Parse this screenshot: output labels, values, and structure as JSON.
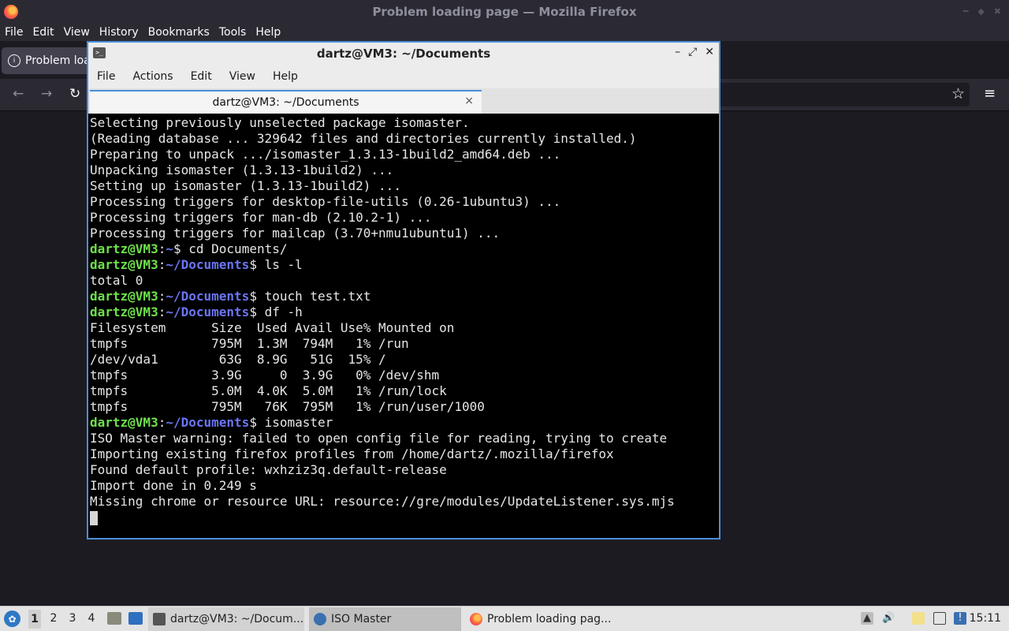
{
  "colors": {
    "terminal_user": "#6ee04c",
    "terminal_path": "#6a75f2",
    "terminal_bg": "#000000",
    "focus_accent": "#4a8fd8",
    "firefox_chrome": "#2b2a33"
  },
  "firefox": {
    "title": "Problem loading page — Mozilla Firefox",
    "menu": [
      "File",
      "Edit",
      "View",
      "History",
      "Bookmarks",
      "Tools",
      "Help"
    ],
    "tab_label": "Problem loa",
    "icons": {
      "back": "arrow-left-icon",
      "forward": "arrow-right-icon",
      "reload": "reload-icon",
      "bookmark": "star-icon",
      "menu": "hamburger-icon"
    }
  },
  "terminal": {
    "title": "dartz@VM3: ~/Documents",
    "menu": [
      "File",
      "Actions",
      "Edit",
      "View",
      "Help"
    ],
    "tab_label": "dartz@VM3: ~/Documents",
    "tab_close": "×",
    "lines": [
      {
        "text": "Selecting previously unselected package isomaster."
      },
      {
        "text": "(Reading database ... 329642 files and directories currently installed.)"
      },
      {
        "text": "Preparing to unpack .../isomaster_1.3.13-1build2_amd64.deb ..."
      },
      {
        "text": "Unpacking isomaster (1.3.13-1build2) ..."
      },
      {
        "text": "Setting up isomaster (1.3.13-1build2) ..."
      },
      {
        "text": "Processing triggers for desktop-file-utils (0.26-1ubuntu3) ..."
      },
      {
        "text": "Processing triggers for man-db (2.10.2-1) ..."
      },
      {
        "text": "Processing triggers for mailcap (3.70+nmu1ubuntu1) ..."
      },
      {
        "user": "dartz@VM3",
        "path": "~",
        "cmd": " cd Documents/"
      },
      {
        "user": "dartz@VM3",
        "path": "~/Documents",
        "cmd": " ls -l"
      },
      {
        "text": "total 0"
      },
      {
        "user": "dartz@VM3",
        "path": "~/Documents",
        "cmd": " touch test.txt"
      },
      {
        "user": "dartz@VM3",
        "path": "~/Documents",
        "cmd": " df -h"
      },
      {
        "text": "Filesystem      Size  Used Avail Use% Mounted on"
      },
      {
        "text": "tmpfs           795M  1.3M  794M   1% /run"
      },
      {
        "text": "/dev/vda1        63G  8.9G   51G  15% /"
      },
      {
        "text": "tmpfs           3.9G     0  3.9G   0% /dev/shm"
      },
      {
        "text": "tmpfs           5.0M  4.0K  5.0M   1% /run/lock"
      },
      {
        "text": "tmpfs           795M   76K  795M   1% /run/user/1000"
      },
      {
        "user": "dartz@VM3",
        "path": "~/Documents",
        "cmd": " isomaster"
      },
      {
        "text": "ISO Master warning: failed to open config file for reading, trying to create"
      },
      {
        "text": "Importing existing firefox profiles from /home/dartz/.mozilla/firefox"
      },
      {
        "text": "Found default profile: wxhziz3q.default-release"
      },
      {
        "text": "Import done in 0.249 s"
      },
      {
        "text": "Missing chrome or resource URL: resource://gre/modules/UpdateListener.sys.mjs"
      }
    ]
  },
  "taskbar": {
    "workspaces": [
      "1",
      "2",
      "3",
      "4"
    ],
    "tasks": {
      "terminal": "dartz@VM3: ~/Docum...",
      "iso": "ISO Master",
      "firefox": "Problem loading pag..."
    },
    "clock": "15:11"
  }
}
